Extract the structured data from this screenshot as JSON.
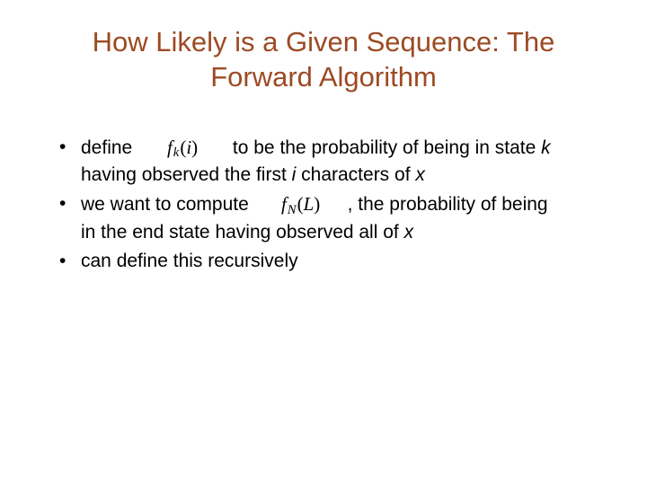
{
  "title": "How Likely is a Given Sequence: The Forward Algorithm",
  "b1": {
    "pre": "define",
    "f": "f",
    "sub": "k",
    "arg": "i",
    "mid1": "to be the probability of being in state ",
    "k": "k",
    "line2a": "having observed the first ",
    "i": "i",
    "line2b": " characters of ",
    "x": "x"
  },
  "b2": {
    "pre": "we want to compute",
    "f": "f",
    "sub": "N",
    "arg": "L",
    "mid": ", the probability of being",
    "line2a": "in the end state having observed all of ",
    "x": "x"
  },
  "b3": {
    "text": "can define this recursively"
  }
}
